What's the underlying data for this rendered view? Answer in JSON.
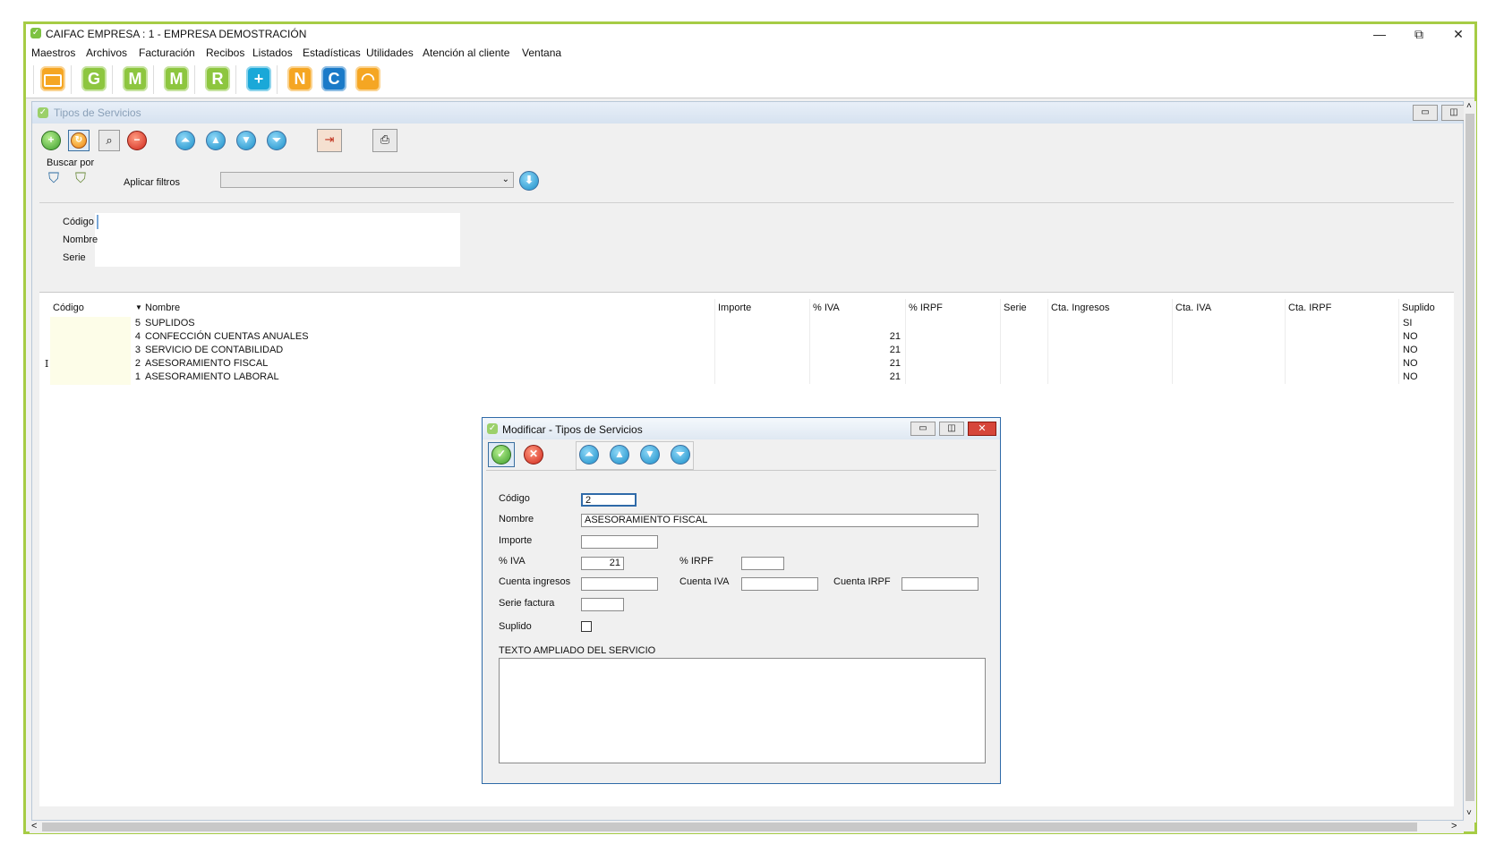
{
  "app": {
    "title": "CAIFAC EMPRESA : 1 - EMPRESA DEMOSTRACIÓN",
    "minimize": "—",
    "restore": "⧉",
    "close": "✕",
    "accent": "#a6cc45"
  },
  "menu": [
    "Maestros",
    "Archivos",
    "Facturación",
    "Recibos",
    "Listados",
    "Estadísticas",
    "Utilidades",
    "Atención al cliente",
    "Ventana"
  ],
  "toolbar_icons": [
    {
      "name": "folder-icon",
      "glyph": "",
      "color": "#f5a623"
    },
    {
      "name": "gf-icon",
      "glyph": "G",
      "color": "#8dc63f"
    },
    {
      "name": "mf-icon",
      "glyph": "M",
      "color": "#8dc63f"
    },
    {
      "name": "mr-icon",
      "glyph": "M",
      "color": "#8dc63f"
    },
    {
      "name": "rm-icon",
      "glyph": "R",
      "color": "#8dc63f"
    },
    {
      "name": "plus-icon",
      "glyph": "+",
      "color": "#1aa8d8"
    },
    {
      "name": "n-icon",
      "glyph": "N",
      "color": "#f5a623"
    },
    {
      "name": "c-icon",
      "glyph": "C",
      "color": "#1a7ac8"
    },
    {
      "name": "headset-icon",
      "glyph": "◠",
      "color": "#f5a623"
    }
  ],
  "child": {
    "title": "Tipos de Servicios",
    "buscar_por": "Buscar por",
    "aplicar_filtros": "Aplicar filtros",
    "filter_labels": [
      "Código",
      "Nombre",
      "Serie"
    ]
  },
  "grid": {
    "headers": [
      "Código",
      "Nombre",
      "Importe",
      "% IVA",
      "% IRPF",
      "Serie",
      "Cta. Ingresos",
      "Cta. IVA",
      "Cta. IRPF",
      "Suplido"
    ],
    "sort_indicator": "▼",
    "rows": [
      {
        "codigo": "5",
        "nombre": "SUPLIDOS",
        "iva": "",
        "suplido": "SI"
      },
      {
        "codigo": "4",
        "nombre": "CONFECCIÓN CUENTAS ANUALES",
        "iva": "21",
        "suplido": "NO"
      },
      {
        "codigo": "3",
        "nombre": "SERVICIO DE CONTABILIDAD",
        "iva": "21",
        "suplido": "NO"
      },
      {
        "codigo": "2",
        "nombre": "ASESORAMIENTO FISCAL",
        "iva": "21",
        "suplido": "NO"
      },
      {
        "codigo": "1",
        "nombre": "ASESORAMIENTO LABORAL",
        "iva": "21",
        "suplido": "NO"
      }
    ]
  },
  "dialog": {
    "title": "Modificar - Tipos de Servicios",
    "labels": {
      "codigo": "Código",
      "nombre": "Nombre",
      "importe": "Importe",
      "iva": "% IVA",
      "irpf": "% IRPF",
      "cuenta_ingresos": "Cuenta ingresos",
      "cuenta_iva": "Cuenta IVA",
      "cuenta_irpf": "Cuenta IRPF",
      "serie_factura": "Serie factura",
      "suplido": "Suplido",
      "texto": "TEXTO AMPLIADO DEL SERVICIO"
    },
    "values": {
      "codigo": "2",
      "nombre": "ASESORAMIENTO FISCAL",
      "importe": "",
      "iva": "21",
      "irpf": "",
      "cuenta_ingresos": "",
      "cuenta_iva": "",
      "cuenta_irpf": "",
      "serie_factura": "",
      "texto": ""
    },
    "suplido_checked": false
  },
  "scroll": {
    "left": "<",
    "right": ">",
    "up": "˄",
    "down": "˅"
  }
}
